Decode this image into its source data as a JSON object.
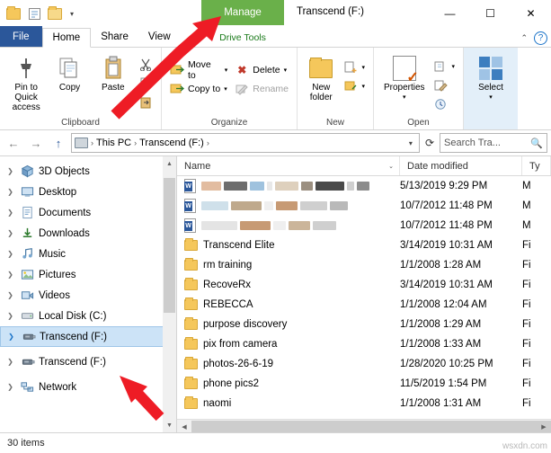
{
  "window": {
    "title": "Transcend (F:)",
    "quick_access": [
      "folder-icon",
      "properties-icon",
      "new-folder-icon",
      "dropdown-chevron"
    ],
    "controls": {
      "minimize": "—",
      "maximize": "☐",
      "close": "✕"
    }
  },
  "contextual_tab": {
    "group_label": "Drive Tools",
    "tab_label": "Manage"
  },
  "ribbon_tabs": [
    {
      "label": "File",
      "id": "file"
    },
    {
      "label": "Home",
      "id": "home"
    },
    {
      "label": "Share",
      "id": "share"
    },
    {
      "label": "View",
      "id": "view"
    }
  ],
  "ribbon_right": {
    "collapse": "⌃",
    "help": "?"
  },
  "ribbon": {
    "groups": [
      {
        "label": "Clipboard",
        "big": [
          {
            "label": "Pin to Quick access",
            "icon": "pin-icon"
          },
          {
            "label": "Copy",
            "icon": "copy-icon"
          },
          {
            "label": "Paste",
            "icon": "paste-icon"
          }
        ],
        "small": [
          {
            "label": "",
            "icon": "cut-icon"
          },
          {
            "label": "",
            "icon": "copy-path-icon"
          },
          {
            "label": "",
            "icon": "paste-shortcut-icon"
          }
        ]
      },
      {
        "label": "Organize",
        "small": [
          {
            "label": "Move to",
            "icon": "move-to-icon"
          },
          {
            "label": "Copy to",
            "icon": "copy-to-icon"
          },
          {
            "label": "Delete",
            "icon": "delete-icon"
          },
          {
            "label": "Rename",
            "icon": "rename-icon"
          }
        ]
      },
      {
        "label": "New",
        "big": [
          {
            "label": "New folder",
            "icon": "new-folder-icon"
          }
        ],
        "small": [
          {
            "label": "",
            "icon": "new-item-icon"
          },
          {
            "label": "",
            "icon": "easy-access-icon"
          }
        ]
      },
      {
        "label": "Open",
        "big": [
          {
            "label": "Properties",
            "icon": "properties-icon"
          }
        ],
        "small": [
          {
            "label": "",
            "icon": "open-icon"
          },
          {
            "label": "",
            "icon": "edit-icon"
          },
          {
            "label": "",
            "icon": "history-icon"
          }
        ]
      },
      {
        "label": "",
        "big": [
          {
            "label": "Select",
            "icon": "select-icon"
          }
        ]
      }
    ]
  },
  "address_bar": {
    "back": "←",
    "forward": "→",
    "up": "↑",
    "breadcrumb": [
      "This PC",
      "Transcend (F:)"
    ],
    "refresh": "⟳",
    "search_placeholder": "Search Tra...",
    "search_value": ""
  },
  "nav_pane": {
    "items": [
      {
        "label": "3D Objects",
        "icon": "3d-objects-icon",
        "expandable": true,
        "selected": false,
        "indent": 0
      },
      {
        "label": "Desktop",
        "icon": "desktop-icon",
        "expandable": true,
        "selected": false,
        "indent": 0
      },
      {
        "label": "Documents",
        "icon": "documents-icon",
        "expandable": true,
        "selected": false,
        "indent": 0
      },
      {
        "label": "Downloads",
        "icon": "downloads-icon",
        "expandable": true,
        "selected": false,
        "indent": 0
      },
      {
        "label": "Music",
        "icon": "music-icon",
        "expandable": true,
        "selected": false,
        "indent": 0
      },
      {
        "label": "Pictures",
        "icon": "pictures-icon",
        "expandable": true,
        "selected": false,
        "indent": 0
      },
      {
        "label": "Videos",
        "icon": "videos-icon",
        "expandable": true,
        "selected": false,
        "indent": 0
      },
      {
        "label": "Local Disk (C:)",
        "icon": "drive-icon",
        "expandable": true,
        "selected": false,
        "indent": 0
      },
      {
        "label": "Transcend (F:)",
        "icon": "usb-drive-icon",
        "expandable": true,
        "selected": true,
        "indent": 0
      },
      {
        "label": "Transcend (F:)",
        "icon": "usb-drive-icon",
        "expandable": true,
        "selected": false,
        "indent": 0
      },
      {
        "label": "Network",
        "icon": "network-icon",
        "expandable": true,
        "selected": false,
        "indent": 0
      }
    ]
  },
  "file_list": {
    "columns": [
      "Name",
      "Date modified",
      "Ty"
    ],
    "rows": [
      {
        "name": "",
        "redacted": true,
        "date": "5/13/2019 9:29 PM",
        "type": "M",
        "icon": "word-doc-icon"
      },
      {
        "name": "",
        "redacted": true,
        "date": "10/7/2012 11:48 PM",
        "type": "M",
        "icon": "word-doc-icon"
      },
      {
        "name": "",
        "redacted": true,
        "date": "10/7/2012 11:48 PM",
        "type": "M",
        "icon": "word-doc-icon"
      },
      {
        "name": "Transcend Elite",
        "redacted": false,
        "date": "3/14/2019 10:31 AM",
        "type": "Fi",
        "icon": "folder-icon"
      },
      {
        "name": "rm training",
        "redacted": false,
        "date": "1/1/2008 1:28 AM",
        "type": "Fi",
        "icon": "folder-icon"
      },
      {
        "name": "RecoveRx",
        "redacted": false,
        "date": "3/14/2019 10:31 AM",
        "type": "Fi",
        "icon": "folder-icon"
      },
      {
        "name": "REBECCA",
        "redacted": false,
        "date": "1/1/2008 12:04 AM",
        "type": "Fi",
        "icon": "folder-icon"
      },
      {
        "name": "purpose discovery",
        "redacted": false,
        "date": "1/1/2008 1:29 AM",
        "type": "Fi",
        "icon": "folder-icon"
      },
      {
        "name": "pix from camera",
        "redacted": false,
        "date": "1/1/2008 1:33 AM",
        "type": "Fi",
        "icon": "folder-icon"
      },
      {
        "name": "photos-26-6-19",
        "redacted": false,
        "date": "1/28/2020 10:25 PM",
        "type": "Fi",
        "icon": "folder-icon"
      },
      {
        "name": "phone pics2",
        "redacted": false,
        "date": "11/5/2019 1:54 PM",
        "type": "Fi",
        "icon": "folder-icon"
      },
      {
        "name": "naomi",
        "redacted": false,
        "date": "1/1/2008 1:31 AM",
        "type": "Fi",
        "icon": "folder-icon"
      }
    ]
  },
  "status_bar": {
    "text": "30 items"
  },
  "watermark": {
    "text": "wsxdn.com"
  },
  "annotations": {
    "arrow_color": "#ee1c25",
    "arrows": [
      "arrow-to-manage-tab",
      "arrow-to-transcend-drive"
    ]
  }
}
